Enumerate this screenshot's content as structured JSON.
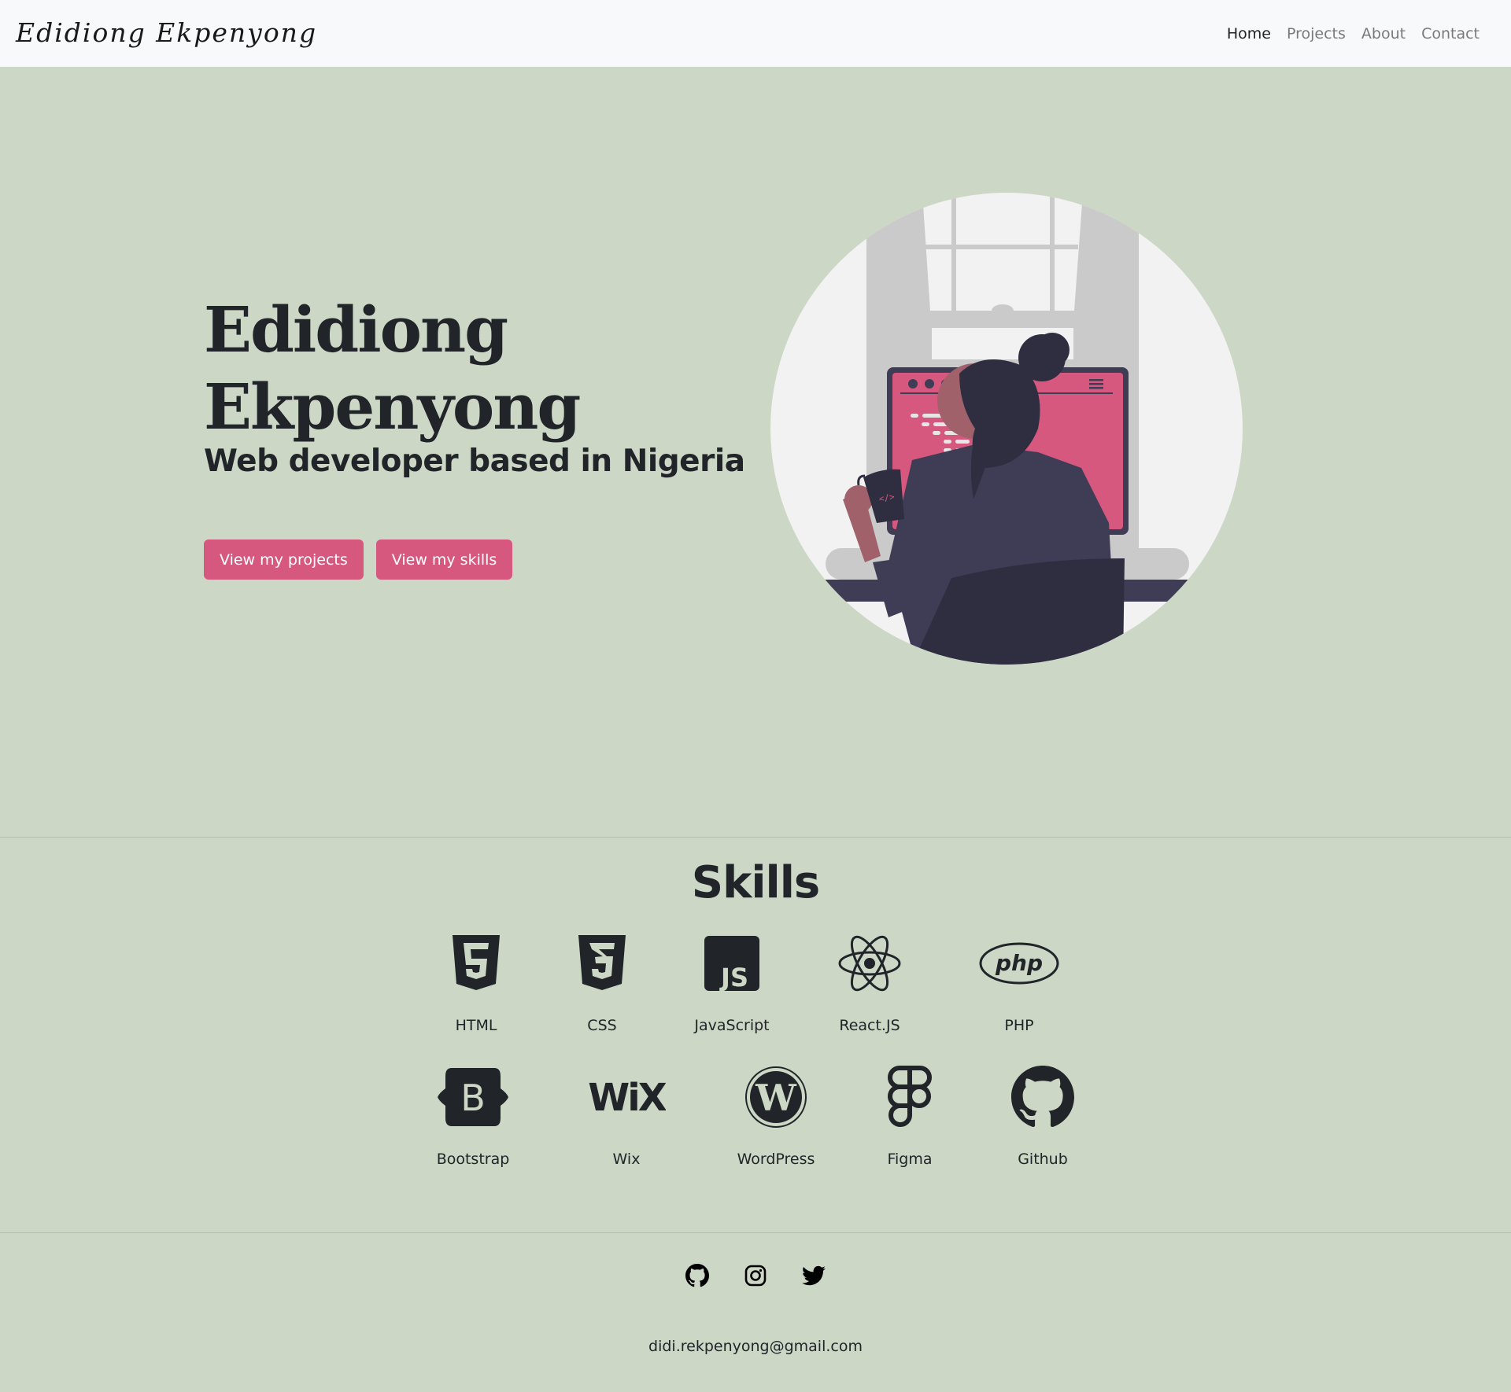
{
  "navbar": {
    "brand": "Edidiong Ekpenyong",
    "links": [
      {
        "label": "Home",
        "active": true
      },
      {
        "label": "Projects",
        "active": false
      },
      {
        "label": "About",
        "active": false
      },
      {
        "label": "Contact",
        "active": false
      }
    ]
  },
  "hero": {
    "title_line1": "Edidiong",
    "title_line2": "Ekpenyong",
    "subtitle": "Web developer based in Nigeria",
    "buttons": {
      "projects": "View my projects",
      "skills": "View my skills"
    },
    "illustration": "woman-coding-at-computer-illustration"
  },
  "skills": {
    "title": "Skills",
    "items": [
      {
        "label": "HTML",
        "icon": "html5-icon"
      },
      {
        "label": "CSS",
        "icon": "css3-icon"
      },
      {
        "label": "JavaScript",
        "icon": "javascript-icon"
      },
      {
        "label": "React.JS",
        "icon": "react-icon"
      },
      {
        "label": "PHP",
        "icon": "php-icon"
      },
      {
        "label": "Bootstrap",
        "icon": "bootstrap-icon"
      },
      {
        "label": "Wix",
        "icon": "wix-icon"
      },
      {
        "label": "WordPress",
        "icon": "wordpress-icon"
      },
      {
        "label": "Figma",
        "icon": "figma-icon"
      },
      {
        "label": "Github",
        "icon": "github-icon"
      }
    ]
  },
  "footer": {
    "social": [
      "github-icon",
      "instagram-icon",
      "twitter-icon"
    ],
    "email": "didi.rekpenyong@gmail.com"
  },
  "colors": {
    "background": "#ccd7c5",
    "navbar": "#f8f9fa",
    "accent": "#d6587e",
    "text": "#212529"
  }
}
